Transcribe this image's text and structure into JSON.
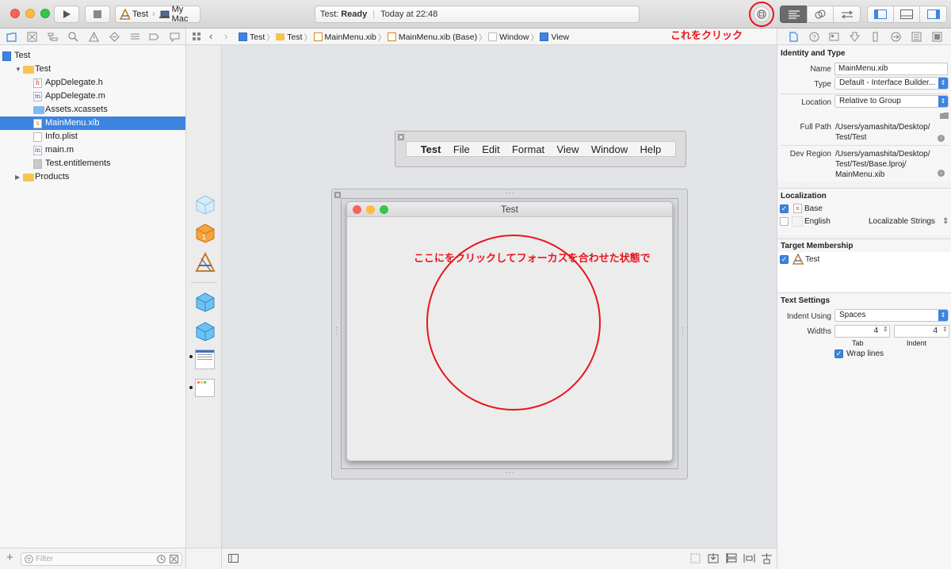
{
  "toolbar": {
    "scheme": "Test",
    "destination": "My Mac",
    "activity_project": "Test:",
    "activity_status": "Ready",
    "activity_time": "Today at 22:48"
  },
  "annotations": {
    "top": "これをクリック",
    "canvas": "ここにをクリックしてフォーカスを合わせた状態で"
  },
  "navigator": {
    "items": [
      {
        "label": "Test",
        "kind": "project"
      },
      {
        "label": "Test",
        "kind": "folder"
      },
      {
        "label": "AppDelegate.h",
        "kind": "h"
      },
      {
        "label": "AppDelegate.m",
        "kind": "m"
      },
      {
        "label": "Assets.xcassets",
        "kind": "assets"
      },
      {
        "label": "MainMenu.xib",
        "kind": "xib",
        "selected": true
      },
      {
        "label": "Info.plist",
        "kind": "plist"
      },
      {
        "label": "main.m",
        "kind": "m"
      },
      {
        "label": "Test.entitlements",
        "kind": "entitlements"
      },
      {
        "label": "Products",
        "kind": "folder"
      }
    ],
    "filter_placeholder": "Filter"
  },
  "jumpbar": [
    "Test",
    "Test",
    "MainMenu.xib",
    "MainMenu.xib (Base)",
    "Window",
    "View"
  ],
  "menubar": [
    "Test",
    "File",
    "Edit",
    "Format",
    "View",
    "Window",
    "Help"
  ],
  "window": {
    "title": "Test"
  },
  "inspector": {
    "identity_header": "Identity and Type",
    "name_label": "Name",
    "name_value": "MainMenu.xib",
    "type_label": "Type",
    "type_value": "Default - Interface Builder...",
    "location_label": "Location",
    "location_value": "Relative to Group",
    "fullpath_label": "Full Path",
    "fullpath_value": "/Users/yamashita/Desktop/ Test/Test",
    "devregion_label": "Dev Region",
    "devregion_value": "/Users/yamashita/Desktop/ Test/Test/Base.lproj/ MainMenu.xib",
    "localization_header": "Localization",
    "loc_base": "Base",
    "loc_english": "English",
    "loc_english_type": "Localizable Strings",
    "target_header": "Target Membership",
    "target_name": "Test",
    "text_header": "Text Settings",
    "indent_label": "Indent Using",
    "indent_value": "Spaces",
    "widths_label": "Widths",
    "tab_value": "4",
    "indent_width_value": "4",
    "tab_label": "Tab",
    "indent_caption": "Indent",
    "wrap_label": "Wrap lines"
  },
  "colors": {
    "accent": "#3d84e0",
    "annotation": "#e8151c"
  }
}
